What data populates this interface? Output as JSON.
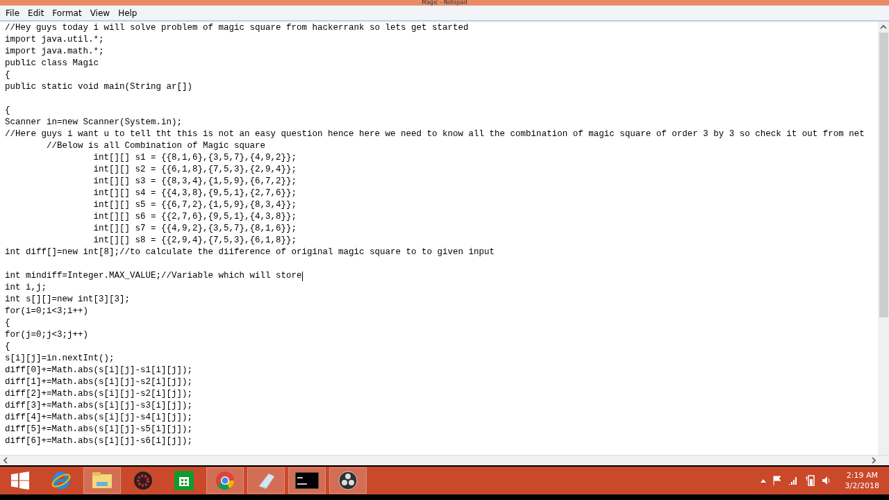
{
  "window": {
    "title": "Magic - Notepad"
  },
  "menu": [
    "File",
    "Edit",
    "Format",
    "View",
    "Help"
  ],
  "blocks": [
    [
      {
        "text": "//Hey guys today i will solve problem of magic square from hackerrank so lets get started",
        "caret": false
      },
      {
        "text": "import java.util.*;",
        "caret": false
      },
      {
        "text": "import java.math.*;",
        "caret": false
      },
      {
        "text": "public class Magic",
        "caret": false
      },
      {
        "text": "{",
        "caret": false
      },
      {
        "text": "public static void main(String ar[])",
        "caret": false
      }
    ],
    [
      {
        "text": "{",
        "caret": false
      },
      {
        "text": "Scanner in=new Scanner(System.in);",
        "caret": false
      },
      {
        "text": "//Here guys i want u to tell tht this is not an easy question hence here we need to know all the combination of magic square of order 3 by 3 so check it out from net",
        "caret": false
      },
      {
        "text": "        //Below is all Combination of Magic square",
        "caret": false
      },
      {
        "text": "                 int[][] s1 = {{8,1,6},{3,5,7},{4,9,2}};",
        "caret": false
      },
      {
        "text": "                 int[][] s2 = {{6,1,8},{7,5,3},{2,9,4}};",
        "caret": false
      },
      {
        "text": "                 int[][] s3 = {{8,3,4},{1,5,9},{6,7,2}};",
        "caret": false
      },
      {
        "text": "                 int[][] s4 = {{4,3,8},{9,5,1},{2,7,6}};",
        "caret": false
      },
      {
        "text": "                 int[][] s5 = {{6,7,2},{1,5,9},{8,3,4}};",
        "caret": false
      },
      {
        "text": "                 int[][] s6 = {{2,7,6},{9,5,1},{4,3,8}};",
        "caret": false
      },
      {
        "text": "                 int[][] s7 = {{4,9,2},{3,5,7},{8,1,6}};",
        "caret": false
      },
      {
        "text": "                 int[][] s8 = {{2,9,4},{7,5,3},{6,1,8}};",
        "caret": false
      },
      {
        "text": "int diff[]=new int[8];//to calculate the diiference of original magic square to to given input",
        "caret": false
      }
    ],
    [
      {
        "text": "int mindiff=Integer.MAX_VALUE;//Variable which will store",
        "caret": true
      },
      {
        "text": "int i,j;",
        "caret": false
      },
      {
        "text": "int s[][]=new int[3][3];",
        "caret": false
      },
      {
        "text": "for(i=0;i<3;i++)",
        "caret": false
      },
      {
        "text": "{",
        "caret": false
      },
      {
        "text": "for(j=0;j<3;j++)",
        "caret": false
      },
      {
        "text": "{",
        "caret": false
      },
      {
        "text": "s[i][j]=in.nextInt();",
        "caret": false
      },
      {
        "text": "diff[0]+=Math.abs(s[i][j]-s1[i][j]);",
        "caret": false
      },
      {
        "text": "diff[1]+=Math.abs(s[i][j]-s2[i][j]);",
        "caret": false
      },
      {
        "text": "diff[2]+=Math.abs(s[i][j]-s2[i][j]);",
        "caret": false
      },
      {
        "text": "diff[3]+=Math.abs(s[i][j]-s3[i][j]);",
        "caret": false
      },
      {
        "text": "diff[4]+=Math.abs(s[i][j]-s4[i][j]);",
        "caret": false
      },
      {
        "text": "diff[5]+=Math.abs(s[i][j]-s5[i][j]);",
        "caret": false
      },
      {
        "text": "diff[6]+=Math.abs(s[i][j]-s6[i][j]);",
        "caret": false
      }
    ]
  ],
  "taskbar": [
    {
      "kind": "start",
      "selected": false
    },
    {
      "kind": "browser",
      "selected": false
    },
    {
      "kind": "folder",
      "selected": true
    },
    {
      "kind": "gear",
      "selected": false
    },
    {
      "kind": "store",
      "selected": false
    },
    {
      "kind": "chrome",
      "selected": true
    },
    {
      "kind": "notepad",
      "selected": true
    },
    {
      "kind": "terminal",
      "selected": true
    },
    {
      "kind": "obs",
      "selected": true
    }
  ],
  "clock": {
    "time": "2:19 AM",
    "date": "3/2/2018"
  }
}
